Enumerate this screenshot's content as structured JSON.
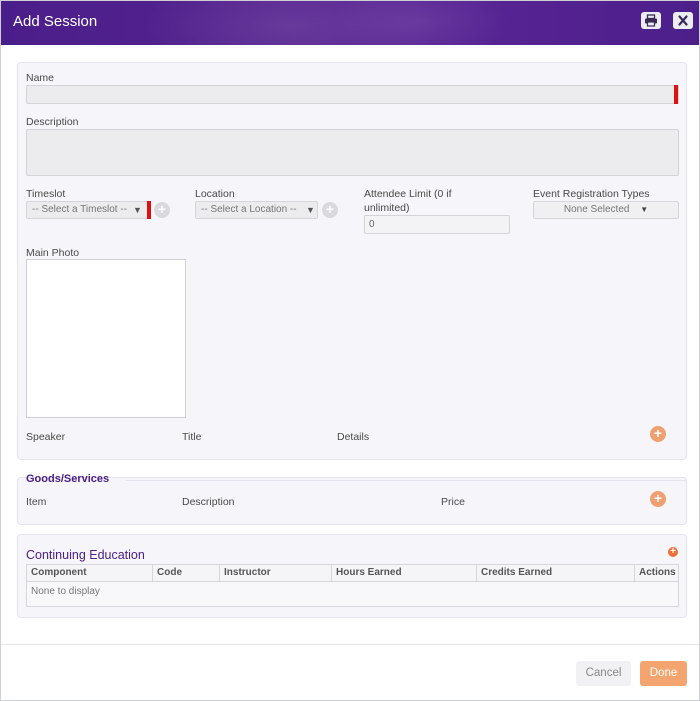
{
  "dialog": {
    "title": "Add Session",
    "header_icons": [
      "print-icon",
      "close-icon"
    ]
  },
  "form": {
    "name_label": "Name",
    "name_value": "",
    "description_label": "Description",
    "description_value": "",
    "timeslot_label": "Timeslot",
    "timeslot_value": "-- Select a Timeslot --",
    "location_label": "Location",
    "location_value": "-- Select a Location --",
    "attendee_limit_label": "Attendee Limit (0 if unlimited)",
    "attendee_limit_value": "0",
    "reg_types_label": "Event Registration Types",
    "reg_types_value": "None Selected",
    "main_photo_label": "Main Photo"
  },
  "speakers": {
    "columns": [
      "Speaker",
      "Title",
      "Details"
    ]
  },
  "goods": {
    "title": "Goods/Services",
    "columns": [
      "Item",
      "Description",
      "Price"
    ]
  },
  "continuing_education": {
    "title": "Continuing Education",
    "columns": [
      "Component",
      "Code",
      "Instructor",
      "Hours Earned",
      "Credits Earned",
      "Actions"
    ],
    "empty_text": "None to display"
  },
  "footer": {
    "cancel_label": "Cancel",
    "done_label": "Done"
  },
  "colors": {
    "header": "#4f2190",
    "accent_orange": "#f4a46e",
    "required_marker": "#e01010"
  }
}
